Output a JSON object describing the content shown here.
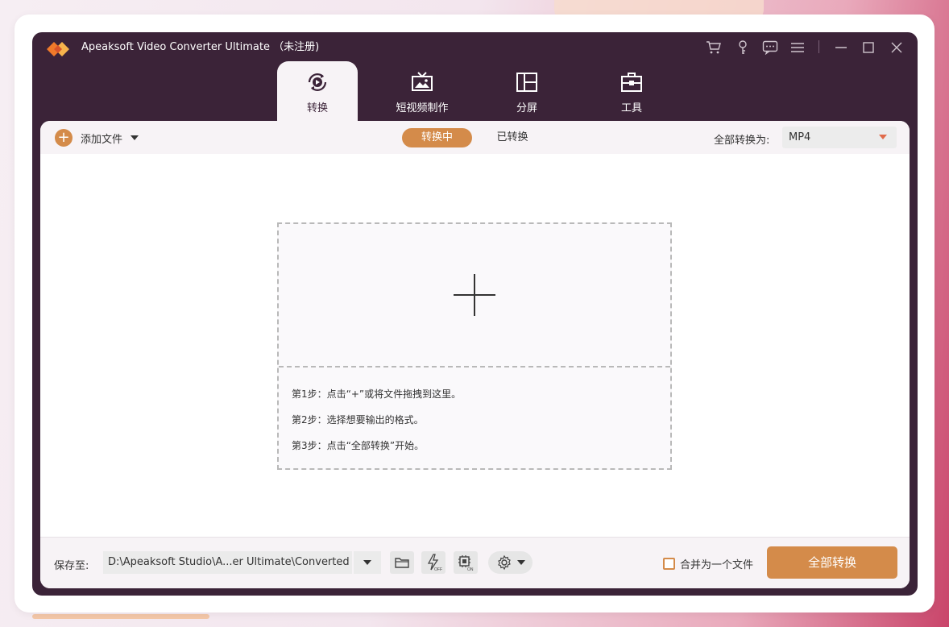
{
  "app": {
    "title": "Apeaksoft Video Converter Ultimate （未注册)"
  },
  "titlebar_icons": [
    "cart-icon",
    "key-icon",
    "feedback-icon",
    "menu-icon",
    "minimize-icon",
    "maximize-icon",
    "close-icon"
  ],
  "tabs": [
    {
      "label": "转换",
      "icon": "convert-icon",
      "active": true
    },
    {
      "label": "短视频制作",
      "icon": "mv-icon",
      "active": false
    },
    {
      "label": "分屏",
      "icon": "collage-icon",
      "active": false
    },
    {
      "label": "工具",
      "icon": "toolbox-icon",
      "active": false
    }
  ],
  "toolbar": {
    "add_label": "添加文件",
    "segment_active": "转换中",
    "segment_other": "已转换",
    "convert_all_to_label": "全部转换为:",
    "format_value": "MP4"
  },
  "dropzone": {
    "steps": [
      "第1步：点击“+”或将文件拖拽到这里。",
      "第2步：选择想要输出的格式。",
      "第3步：点击“全部转换”开始。"
    ]
  },
  "bottom": {
    "save_label": "保存至:",
    "path": "D:\\Apeaksoft Studio\\A...er Ultimate\\Converted",
    "merge_label": "合并为一个文件",
    "merge_checked": false,
    "convert_all_label": "全部转换"
  },
  "colors": {
    "accent": "#d48b4a",
    "titlebar": "#3b2338",
    "panel": "#f7f3f6"
  }
}
